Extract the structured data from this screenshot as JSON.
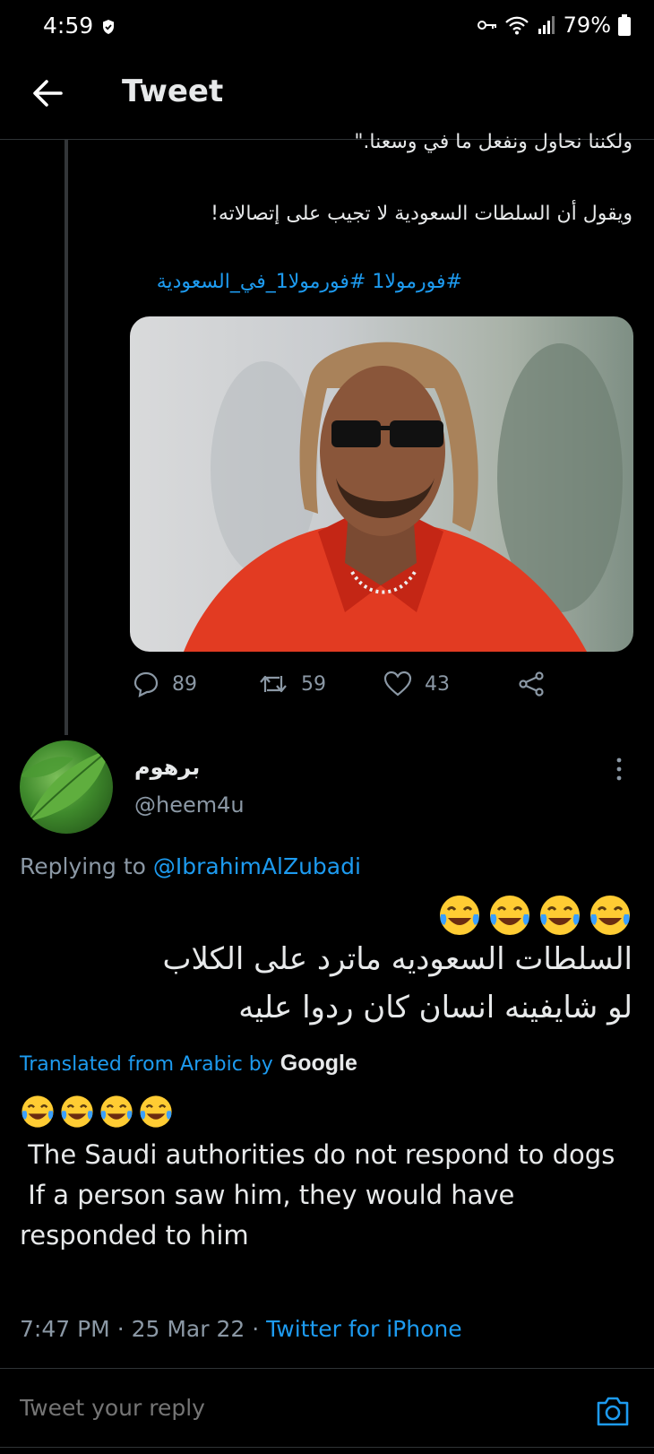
{
  "status_bar": {
    "time": "4:59",
    "battery": "79%"
  },
  "header": {
    "title": "Tweet"
  },
  "parent_tweet": {
    "line1": "ولكننا نحاول ونفعل ما في وسعنا.\"",
    "line2": "ويقول أن السلطات السعودية لا تجيب على إتصالاته!",
    "hashtags": "#فورمولا1 #فورمولا1_في_السعودية",
    "replies": "89",
    "retweets": "59",
    "likes": "43"
  },
  "reply": {
    "display_name": "برهوم",
    "handle": "@heem4u",
    "replying_prefix": "Replying to",
    "replying_to": "@IbrahimAlZubadi",
    "arabic_line1": "السلطات السعوديه ماترد على الكلاب",
    "arabic_line2": "لو شايفينه انسان كان ردوا عليه",
    "translated_label": "Translated from Arabic by",
    "translator": "Google",
    "translation_line1": " The Saudi authorities do not respond to dogs",
    "translation_line2": " If a person saw him, they would have responded to him",
    "time": "7:47 PM",
    "date": "25 Mar 22",
    "source": "Twitter for iPhone"
  },
  "compose": {
    "placeholder": "Tweet your reply"
  },
  "colors": {
    "accent": "#1d9bf0",
    "muted": "#8b98a5",
    "background": "#000000"
  },
  "icons": {
    "back": "arrow-left-icon",
    "reply": "comment-icon",
    "retweet": "retweet-icon",
    "like": "heart-icon",
    "share": "share-icon",
    "more": "more-vertical-icon",
    "camera": "camera-icon",
    "emoji": "face-with-tears-of-joy-emoji"
  }
}
